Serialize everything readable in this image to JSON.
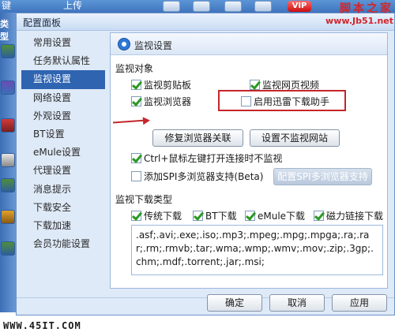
{
  "app_toolbar": {
    "left_text": "键",
    "upload_label": "上传",
    "vip_badge": "VIP",
    "side_label": "类型"
  },
  "watermark_top": {
    "line1": "脚本之家",
    "line2": "www.Jb51.net"
  },
  "dialog": {
    "title": "配置面板",
    "nav": [
      {
        "label": "常用设置",
        "active": false
      },
      {
        "label": "任务默认属性",
        "active": false
      },
      {
        "label": "监视设置",
        "active": true
      },
      {
        "label": "网络设置",
        "active": false
      },
      {
        "label": "外观设置",
        "active": false
      },
      {
        "label": "BT设置",
        "active": false
      },
      {
        "label": "eMule设置",
        "active": false
      },
      {
        "label": "代理设置",
        "active": false
      },
      {
        "label": "消息提示",
        "active": false
      },
      {
        "label": "下载安全",
        "active": false
      },
      {
        "label": "下载加速",
        "active": false
      },
      {
        "label": "会员功能设置",
        "active": false
      }
    ],
    "panel": {
      "title": "监视设置",
      "monitor_objects": {
        "title": "监视对象",
        "clipboard": {
          "label": "监视剪贴板",
          "checked": true
        },
        "web_video": {
          "label": "监视网页视频",
          "checked": true
        },
        "browser": {
          "label": "监视浏览器",
          "checked": true
        },
        "helper": {
          "label": "启用迅雷下载助手",
          "checked": false
        }
      },
      "repair_button": "修复浏览器关联",
      "no_monitor_button": "设置不监视网站",
      "ctrl_click": {
        "label": "Ctrl+鼠标左键打开连接时不监视",
        "checked": true
      },
      "spi": {
        "label": "添加SPI多浏览器支持(Beta)",
        "checked": false
      },
      "spi_button": "配置SPI多浏览器支持",
      "download_types": {
        "title": "监视下载类型",
        "traditional": {
          "label": "传统下载",
          "checked": true
        },
        "bt": {
          "label": "BT下载",
          "checked": true
        },
        "emule": {
          "label": "eMule下载",
          "checked": true
        },
        "magnet": {
          "label": "磁力链接下载",
          "checked": true
        }
      },
      "extensions": ".asf;.avi;.exe;.iso;.mp3;.mpeg;.mpg;.mpga;.ra;.rar;.rm;.rmvb;.tar;.wma;.wmp;.wmv;.mov;.zip;.3gp;.chm;.mdf;.torrent;.jar;.msi;"
    },
    "ok_button": "确定",
    "cancel_button": "取消",
    "apply_button": "应用"
  },
  "site_watermark": "WWW.45IT.COM",
  "colors": {
    "nav_active": "#2f64b1",
    "highlight": "#c4262b",
    "check": "#2b9a23"
  }
}
